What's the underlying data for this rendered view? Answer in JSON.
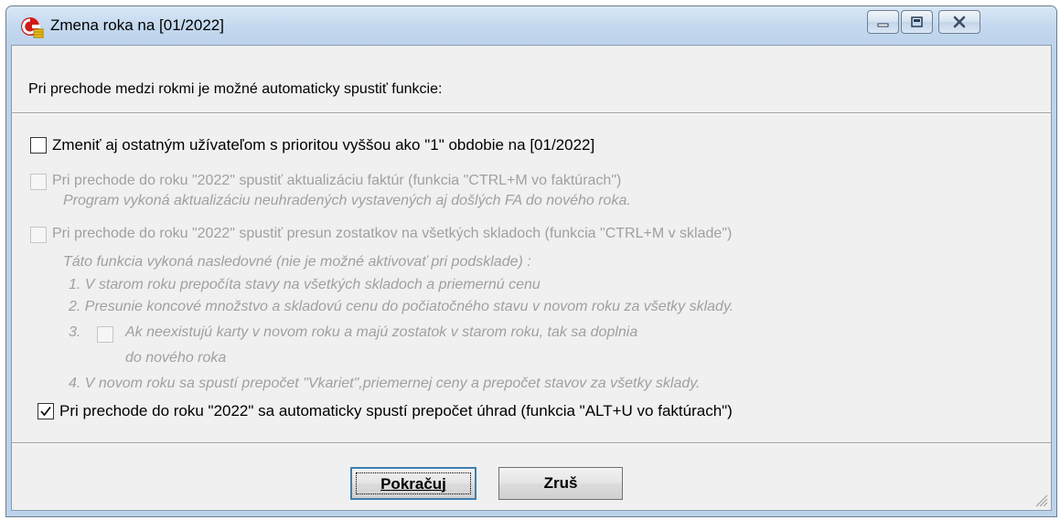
{
  "window": {
    "title": "Zmena roka na [01/2022]"
  },
  "dialog": {
    "intro": "Pri prechode medzi rokmi je možné automaticky spustiť funkcie:",
    "option1": {
      "label": "Zmeniť aj ostatným užívateľom s prioritou vyššou ako \"1\" obdobie na [01/2022]",
      "checked": false,
      "enabled": true
    },
    "option2": {
      "label": "Pri prechode do roku \"2022\" spustiť aktualizáciu faktúr (funkcia \"CTRL+M vo faktúrach\")",
      "description": "Program vykoná aktualizáciu neuhradených vystavených aj došlých FA do nového roka.",
      "checked": false,
      "enabled": false
    },
    "option3": {
      "label": "Pri prechode do roku \"2022\" spustiť presun zostatkov na všetkých skladoch (funkcia \"CTRL+M v sklade\")",
      "description": "Táto funkcia vykoná nasledovné (nie je možné aktivovať pri podsklade) :",
      "step1": "1. V starom roku prepočíta stavy na všetkých skladoch a priemernú cenu",
      "step2": "2. Presunie koncové množstvo a skladovú cenu do počiatočného stavu v novom roku za všetky sklady.",
      "step3_num": "3.",
      "step3_line1": "Ak neexistujú karty v novom roku a majú zostatok v starom roku, tak sa doplnia",
      "step3_line2": "do nového roka",
      "step4": "4. V novom roku sa spustí prepočet \"Vkariet\",priemernej ceny a  prepočet stavov  za všetky sklady.",
      "checked": false,
      "enabled": false
    },
    "option4": {
      "label": "Pri prechode do roku \"2022\" sa automaticky spustí prepočet úhrad (funkcia \"ALT+U vo faktúrach\")",
      "checked": true,
      "enabled": true
    }
  },
  "buttons": {
    "continue_label": "Pokračuj",
    "cancel_label": "Zruš"
  },
  "colors": {
    "disabled_text": "#a0a0a0",
    "focus_border": "#3c7fb1"
  }
}
